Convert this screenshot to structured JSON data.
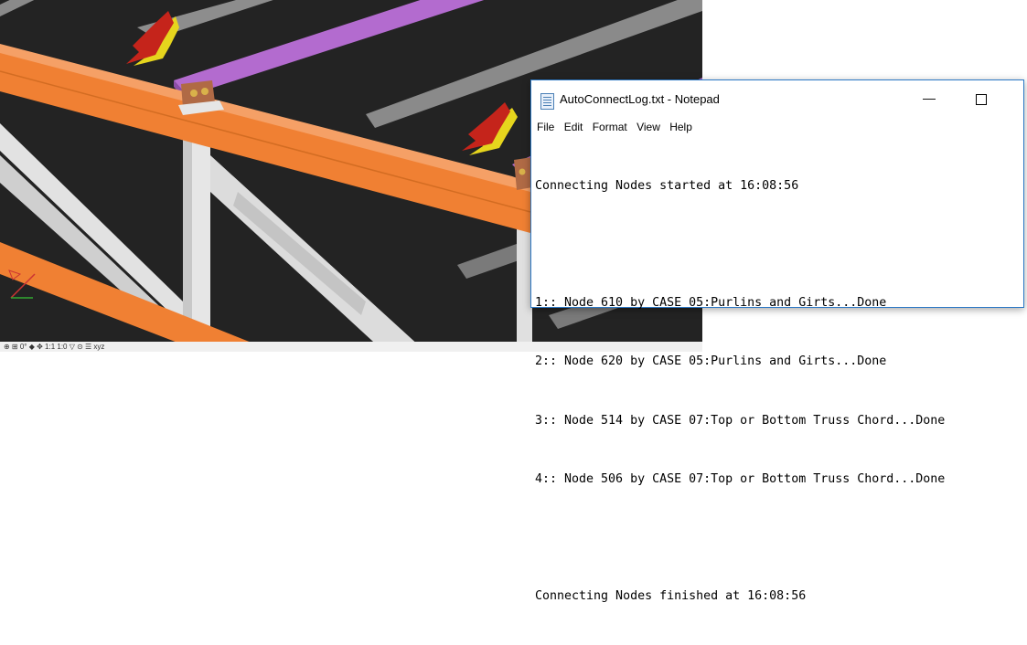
{
  "notepad": {
    "title": "AutoConnectLog.txt - Notepad",
    "minimize_glyph": "—",
    "menu": [
      "File",
      "Edit",
      "Format",
      "View",
      "Help"
    ],
    "lines": [
      "Connecting Nodes started at 16:08:56",
      "",
      "1:: Node 610 by CASE 05:Purlins and Girts...Done",
      "2:: Node 620 by CASE 05:Purlins and Girts...Done",
      "3:: Node 514 by CASE 07:Top or Bottom Truss Chord...Done",
      "4:: Node 506 by CASE 07:Top or Bottom Truss Chord...Done",
      "",
      "Connecting Nodes finished at 16:08:56"
    ]
  },
  "viewport": {
    "background_color": "#232323",
    "truss_color": "#f08033",
    "purlin_color": "#b36bcf",
    "web_color": "#d9d9d9",
    "arrow_color": "#c5241b",
    "arrow_shadow_color": "#e6d51d"
  },
  "statusbar": {
    "text": "⊕ ⊞ 0° ◆ ✥ 1:1 1:0 ▽ ⊙ ☰ xyz"
  }
}
